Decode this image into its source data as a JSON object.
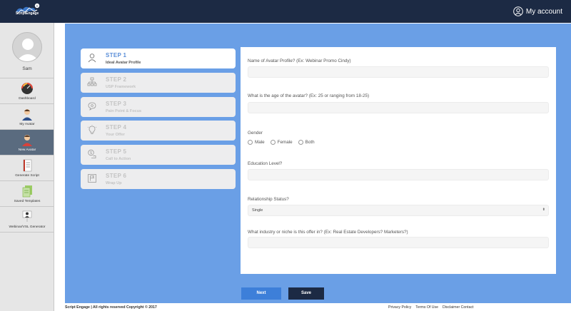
{
  "brand": {
    "logo_text": "ScriptEngage"
  },
  "header": {
    "account_label": "My account"
  },
  "sidebar": {
    "username": "Sam",
    "items": [
      {
        "label": "Dashboard",
        "icon": "gauge-icon"
      },
      {
        "label": "My Avatar",
        "icon": "person-icon"
      },
      {
        "label": "New Avatar",
        "icon": "new-person-icon",
        "active": true
      },
      {
        "label": "Generate Script",
        "icon": "document-icon"
      },
      {
        "label": "Saved Templates",
        "icon": "templates-icon"
      },
      {
        "label": "Webinar/VSL Generator",
        "icon": "presenter-icon"
      }
    ]
  },
  "steps": [
    {
      "title": "STEP 1",
      "subtitle": "Ideal Avatar Profile",
      "icon": "user-outline-icon",
      "active": true
    },
    {
      "title": "STEP 2",
      "subtitle": "USP Framework",
      "icon": "hierarchy-icon"
    },
    {
      "title": "STEP 3",
      "subtitle": "Pain Point & Focus",
      "icon": "speech-bubble-icon"
    },
    {
      "title": "STEP 4",
      "subtitle": "Your Offer",
      "icon": "lightbulb-icon"
    },
    {
      "title": "STEP 5",
      "subtitle": "Call to Action",
      "icon": "hand-coin-icon"
    },
    {
      "title": "STEP 6",
      "subtitle": "Wrap Up",
      "icon": "flag-box-icon"
    }
  ],
  "form": {
    "avatar_name_label": "Name of Avatar Profile? (Ex: Webinar Promo Cindy)",
    "avatar_name_value": "",
    "age_label": "What is the age of the avatar? (Ex: 25 or ranging from 18-25)",
    "age_value": "",
    "gender_label": "Gender",
    "gender_options": [
      "Male",
      "Female",
      "Both"
    ],
    "education_label": "Education Level?",
    "education_value": "",
    "relationship_label": "Relationship Status?",
    "relationship_value": "Single",
    "industry_label": "What industry or niche is this offer in? (Ex: Real Estate Developers? Marketers?)",
    "industry_value": ""
  },
  "buttons": {
    "next_label": "Next",
    "save_label": "Save"
  },
  "footer": {
    "copyright": "Script Engage | All rights reserved Copyright © 2017",
    "links": [
      "Privacy Policy",
      "Terms Of Use",
      "Disclaimer Contact"
    ]
  },
  "colors": {
    "header_bg": "#1c2a44",
    "main_bg": "#6a9fe6",
    "accent": "#5a8ed8",
    "next_button": "#3d7fd9",
    "save_button": "#1c2a44",
    "active_nav": "#5a6b7f"
  }
}
